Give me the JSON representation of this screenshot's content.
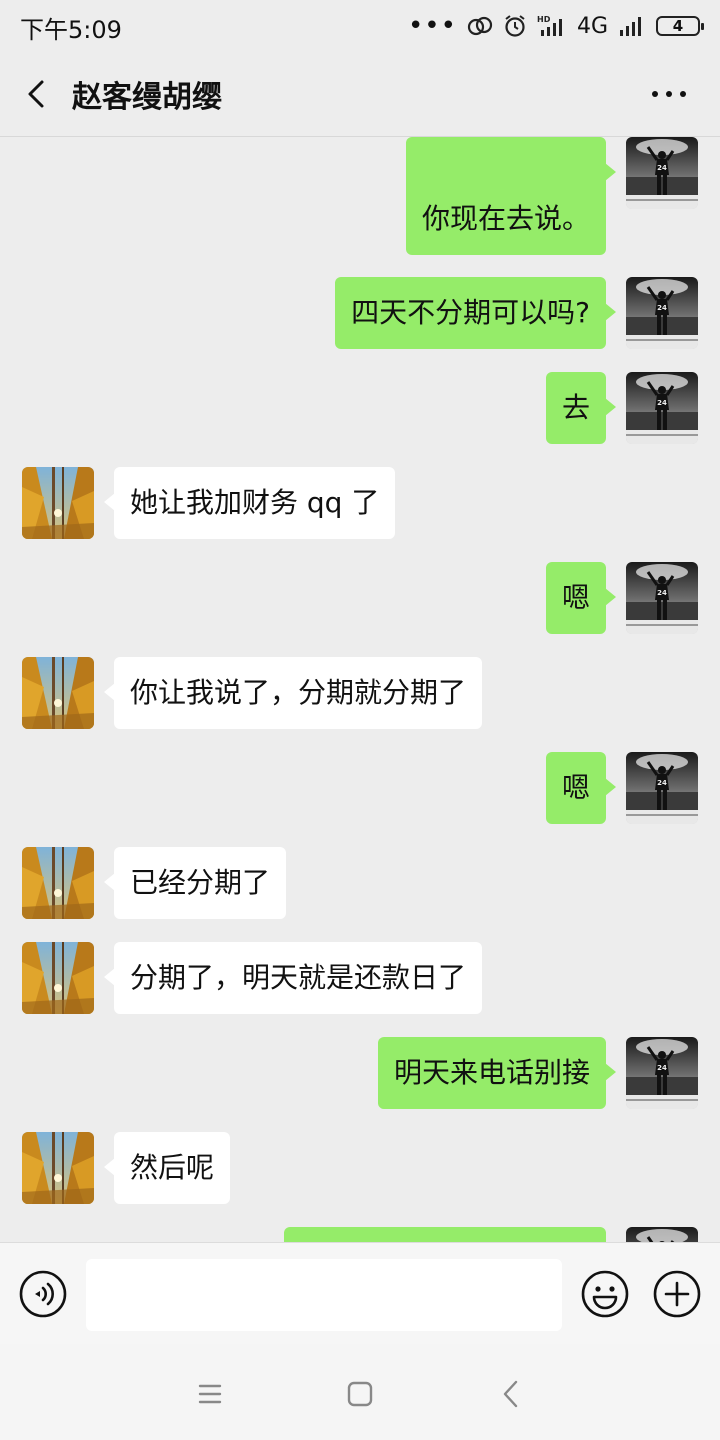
{
  "status_bar": {
    "time": "下午5:09",
    "network_label": "4G",
    "battery_level": "4"
  },
  "header": {
    "title": "赵客缦胡缨",
    "back_icon": "chevron-left-icon",
    "more_icon": "more-horizontal-icon"
  },
  "messages": [
    {
      "sender": "me",
      "text": "你现在去说。"
    },
    {
      "sender": "me",
      "text": "四天不分期可以吗?"
    },
    {
      "sender": "me",
      "text": "去"
    },
    {
      "sender": "them",
      "text": "她让我加财务 qq 了"
    },
    {
      "sender": "me",
      "text": "嗯"
    },
    {
      "sender": "them",
      "text": "你让我说了，分期就分期了"
    },
    {
      "sender": "me",
      "text": "嗯"
    },
    {
      "sender": "them",
      "text": "已经分期了"
    },
    {
      "sender": "them",
      "text": "分期了，明天就是还款日了"
    },
    {
      "sender": "me",
      "text": "明天来电话别接"
    },
    {
      "sender": "them",
      "text": "然后呢"
    },
    {
      "sender": "me",
      "text": ""
    }
  ],
  "input_bar": {
    "value": "",
    "voice_icon": "voice-icon",
    "emoji_icon": "emoji-icon",
    "plus_icon": "plus-icon"
  },
  "colors": {
    "background": "#ededed",
    "my_bubble": "#95ec69",
    "their_bubble": "#ffffff"
  }
}
